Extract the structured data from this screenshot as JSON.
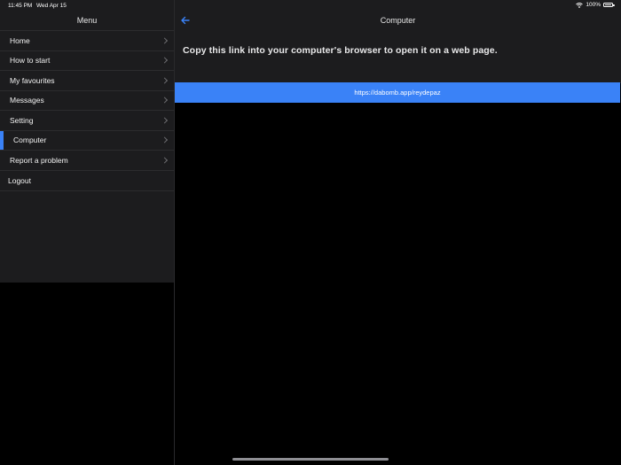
{
  "status_bar": {
    "time": "11:45 PM",
    "date": "Wed Apr 15",
    "battery": "100%",
    "battery_level": 1.0
  },
  "sidebar": {
    "title": "Menu",
    "items": [
      {
        "label": "Home",
        "chevron": true
      },
      {
        "label": "How to start",
        "chevron": true
      },
      {
        "label": "My favourites",
        "chevron": true
      },
      {
        "label": "Messages",
        "chevron": true
      },
      {
        "label": "Setting",
        "chevron": true
      },
      {
        "label": "Computer",
        "chevron": true,
        "selected": true
      },
      {
        "label": "Report a problem",
        "chevron": true
      },
      {
        "label": "Logout",
        "chevron": false
      }
    ]
  },
  "main": {
    "title": "Computer",
    "back_icon": "back-arrow-icon",
    "instruction": "Copy this link into your computer's browser to open it on a web page.",
    "link": "https://dabomb.app/reydepaz"
  },
  "colors": {
    "accent": "#3a82f7",
    "panel": "#1c1c1e",
    "background": "#000000"
  }
}
